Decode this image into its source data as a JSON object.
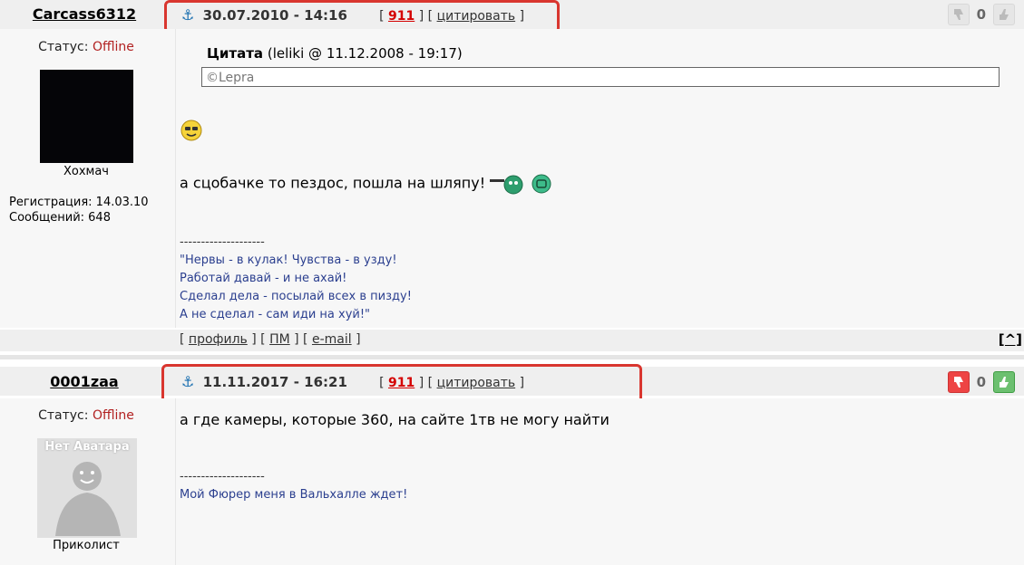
{
  "posts": [
    {
      "username": "Carcass6312",
      "date": "30.07.2010 - 14:16",
      "post_num": "911",
      "quote_label": "цитировать",
      "votes": "0",
      "status_label": "Статус:",
      "status_value": "Offline",
      "user_title": "Хохмач",
      "reg_label": "Регистрация: 14.03.10",
      "msgs_label": "Сообщений: 648",
      "quote_title": "Цитата",
      "quote_meta": "(leliki @ 11.12.2008 - 19:17)",
      "quote_text": "©Lepra",
      "body_text": "а сцобачке то пездос, пошла на шляпу!",
      "sig_dash": "--------------------",
      "sig_lines": [
        "\"Нервы - в кулак! Чувства - в узду!",
        "Работай давай - и не ахай!",
        "Сделал дела - посылай всех в пизду!",
        "А не сделал - сам иди на хуй!\""
      ],
      "footer": {
        "profile": "профиль",
        "pm": "ПМ",
        "email": "e-mail",
        "top": "[^]"
      }
    },
    {
      "username": "0001zaa",
      "date": "11.11.2017 - 16:21",
      "post_num": "911",
      "quote_label": "цитировать",
      "votes": "0",
      "status_label": "Статус:",
      "status_value": "Offline",
      "avatar_text": "Нет Аватара",
      "user_title": "Приколист",
      "body_text": "а где камеры, которые 360, на сайте 1тв не могу найти",
      "sig_dash": "--------------------",
      "sig_lines": [
        "Мой Фюрер меня в Вальхалле ждет!"
      ]
    }
  ],
  "colors": {
    "accent_red": "#d9362f",
    "offline": "#b22222",
    "sig": "#2b3f8f"
  }
}
